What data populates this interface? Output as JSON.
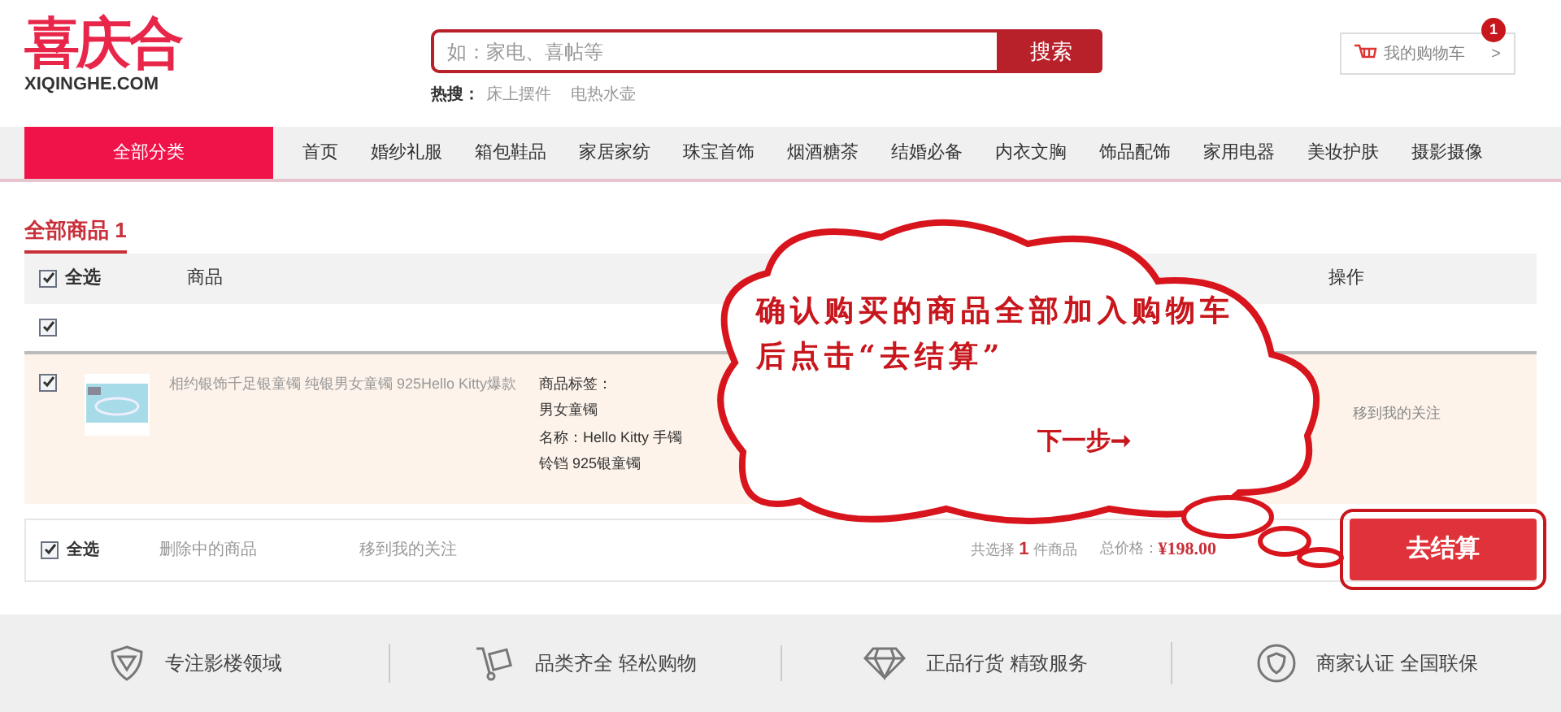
{
  "logo": {
    "name": "喜庆合",
    "domain": "XIQINGHE.COM"
  },
  "search": {
    "placeholder": "如：家电、喜帖等",
    "button": "搜索",
    "hot_label": "热搜：",
    "hot_terms": [
      "床上摆件",
      "电热水壶"
    ]
  },
  "cart": {
    "label": "我的购物车",
    "count": "1",
    "chevron": ">"
  },
  "nav": {
    "all_categories": "全部分类",
    "items": [
      "首页",
      "婚纱礼服",
      "箱包鞋品",
      "家居家纺",
      "珠宝首饰",
      "烟酒糖茶",
      "结婚必备",
      "内衣文胸",
      "饰品配饰",
      "家用电器",
      "美妆护肤",
      "摄影摄像"
    ]
  },
  "tab": {
    "label": "全部商品",
    "count": "1"
  },
  "table": {
    "select_all": {
      "label": "全选",
      "checked": true
    },
    "columns": [
      "商品",
      "操作"
    ],
    "shop_row": {
      "checked": true
    },
    "rows": [
      {
        "checked": true,
        "title": "相约银饰千足银童镯 纯银男女童镯 925Hello Kitty爆款",
        "attributes": [
          "商品标签：",
          "男女童镯",
          "名称：Hello Kitty 手镯",
          "铃铛 925银童镯"
        ],
        "action": "移到我的关注"
      }
    ]
  },
  "footer_bar": {
    "select_all": {
      "label": "全选",
      "checked": true
    },
    "delete": "删除中的商品",
    "move": "移到我的关注",
    "selected_prefix": "共选择",
    "selected_count": "1",
    "selected_suffix": "件商品",
    "total_label": "总价格：",
    "total": "¥198.00",
    "checkout": "去结算"
  },
  "callout": {
    "text": "确认购买的商品全部加入购物车后点击“去结算”",
    "next": "下一步➞"
  },
  "features": [
    {
      "kind": "shield",
      "label": "专注影楼领域"
    },
    {
      "kind": "cart",
      "label": "品类齐全 轻松购物"
    },
    {
      "kind": "diamond",
      "label": "正品行货 精致服务"
    },
    {
      "kind": "badge",
      "label": "商家认证 全国联保"
    }
  ]
}
